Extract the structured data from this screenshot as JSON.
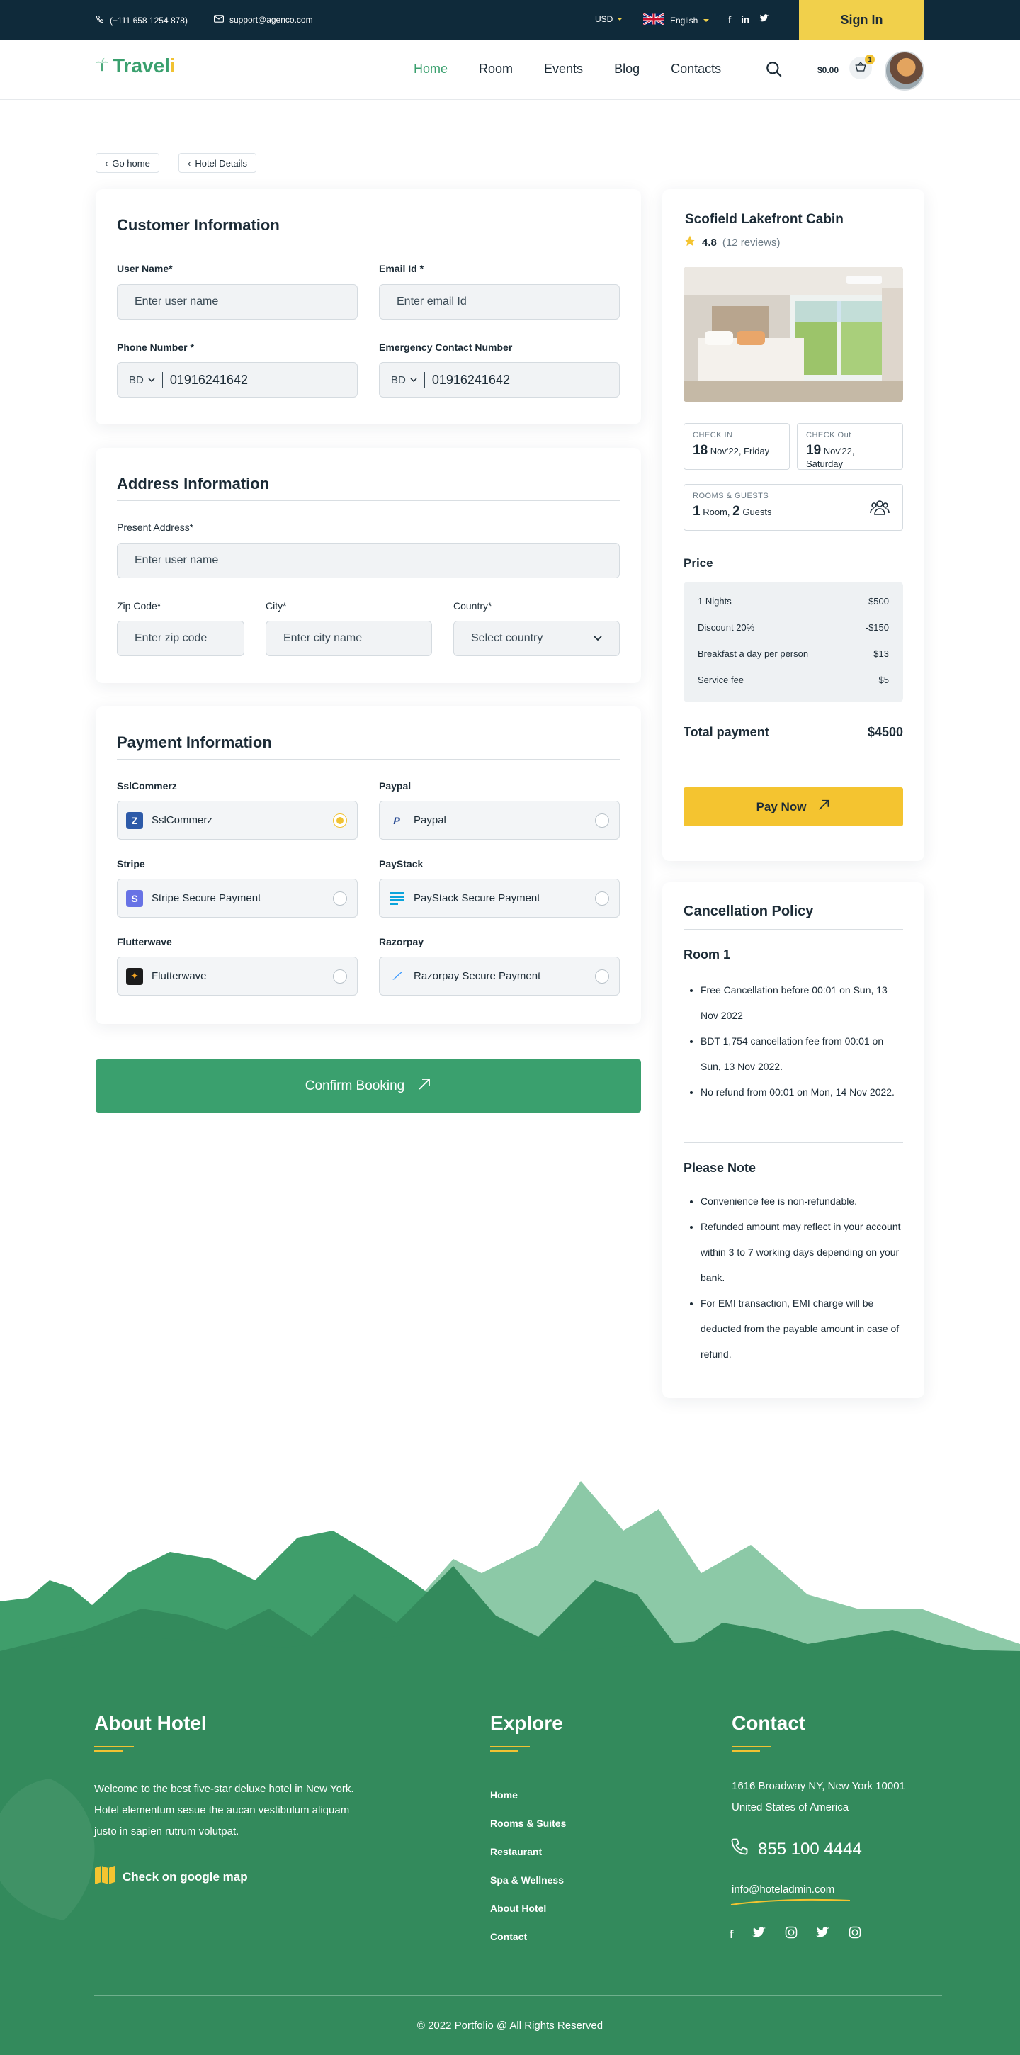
{
  "topbar": {
    "phone": "(+111 658 1254 878)",
    "email": "support@agenco.com",
    "currency": "USD",
    "language": "English",
    "signin": "Sign In"
  },
  "nav": {
    "logo_a": "Travel",
    "logo_b": "i",
    "items": [
      "Home",
      "Room",
      "Events",
      "Blog",
      "Contacts"
    ],
    "cart_total": "$0.00",
    "cart_count": "1"
  },
  "breadcrumb": {
    "home": "Go home",
    "current": "Hotel Details"
  },
  "customer": {
    "title": "Customer Information",
    "user_label": "User Name*",
    "user_placeholder": "Enter user name",
    "email_label": "Email Id *",
    "email_placeholder": "Enter email Id",
    "phone_label": "Phone Number *",
    "phone_code": "BD",
    "phone_value": "01916241642",
    "emergency_label": "Emergency Contact Number",
    "emergency_code": "BD",
    "emergency_value": "01916241642"
  },
  "address": {
    "title": "Address Information",
    "present_label": "Present Address*",
    "present_placeholder": "Enter user name",
    "zip_label": "Zip Code*",
    "zip_placeholder": "Enter zip code",
    "city_label": "City*",
    "city_placeholder": "Enter city name",
    "country_label": "Country*",
    "country_value": "Select country"
  },
  "payment": {
    "title": "Payment Information",
    "methods": [
      {
        "label": "SslCommerz",
        "name": "SslCommerz",
        "selected": true
      },
      {
        "label": "Paypal",
        "name": "Paypal",
        "selected": false
      },
      {
        "label": "Stripe",
        "name": "Stripe Secure Payment",
        "selected": false
      },
      {
        "label": "PayStack",
        "name": "PayStack Secure Payment",
        "selected": false
      },
      {
        "label": "Flutterwave",
        "name": "Flutterwave",
        "selected": false
      },
      {
        "label": "Razorpay",
        "name": "Razorpay Secure Payment",
        "selected": false
      }
    ]
  },
  "confirm": "Confirm Booking",
  "summary": {
    "title": "Scofield Lakefront Cabin",
    "rating": "4.8",
    "reviews": "(12 reviews)",
    "checkin_label": "CHECK IN",
    "checkin_day": "18",
    "checkin_rest": "Nov'22, Friday",
    "checkout_label": "CHECK Out",
    "checkout_day": "19",
    "checkout_rest": "Nov'22, Saturday",
    "guests_label": "ROOMS & GUESTS",
    "rooms_n": "1",
    "rooms_t": "Room,",
    "guests_n": "2",
    "guests_t": "Guests",
    "price_title": "Price",
    "rows": [
      {
        "k": "1 Nights",
        "v": "$500"
      },
      {
        "k": "Discount 20%",
        "v": "-$150"
      },
      {
        "k": "Breakfast a day per person",
        "v": "$13"
      },
      {
        "k": "Service fee",
        "v": "$5"
      }
    ],
    "total_label": "Total payment",
    "total_value": "$4500",
    "paynow": "Pay Now"
  },
  "policy": {
    "title": "Cancellation Policy",
    "room_title": "Room 1",
    "room_items": [
      "Free Cancellation before 00:01 on Sun, 13 Nov 2022",
      "BDT 1,754 cancellation fee from 00:01 on Sun, 13 Nov 2022.",
      "No refund from 00:01 on Mon, 14 Nov 2022."
    ],
    "note_title": "Please Note",
    "note_items": [
      "Convenience fee is non-refundable.",
      "Refunded amount may reflect in your account within 3 to 7 working days depending on your bank.",
      "For EMI transaction, EMI charge will be deducted from the payable amount in case of refund."
    ]
  },
  "footer": {
    "about_title": "About Hotel",
    "about_text": "Welcome to the best five-star deluxe hotel in New York. Hotel elementum sesue the aucan vestibulum aliquam justo in sapien rutrum volutpat.",
    "map_link": "Check on google map",
    "explore_title": "Explore",
    "explore": [
      "Home",
      "Rooms & Suites",
      "Restaurant",
      "Spa & Wellness",
      "About Hotel",
      "Contact"
    ],
    "contact_title": "Contact",
    "address1": "1616 Broadway NY, New York 10001",
    "address2": "United States of America",
    "phone": "855 100 4444",
    "email": "info@hoteladmin.com",
    "copyright": "© 2022 Portfolio @ All Rights Reserved"
  },
  "colors": {
    "green": "#3aa06e",
    "dark": "#0f2a3a",
    "yellow": "#f1c232",
    "footer": "#338a5c"
  }
}
